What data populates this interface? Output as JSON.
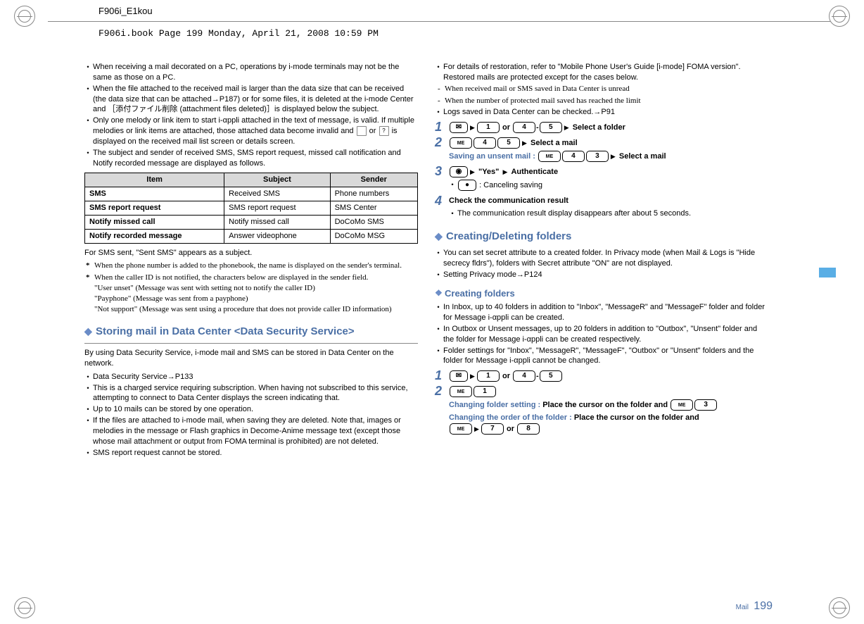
{
  "doc_id": "F906i_E1kou",
  "book_line": "F906i.book  Page 199  Monday, April 21, 2008  10:59 PM",
  "page_label": "Mail",
  "page_number": "199",
  "left": {
    "bullets": [
      "When receiving a mail decorated on a PC, operations by i-mode terminals may not be the same as those on a PC.",
      "When the file attached to the received mail is larger than the data size that can be received (the data size that can be attached→P187) or for some files, it is deleted at the i-mode Center and ［添付ファイル削除 (attachment files deleted)］is displayed below the subject.",
      "Only one melody or link item to start i-αppli attached in the text of message, is valid. If multiple melodies or link items are attached, those attached data become invalid and  or  is displayed on the received mail list screen or details screen.",
      "The subject and sender of received SMS, SMS report request, missed call notification and Notify recorded message are displayed as follows."
    ],
    "table": {
      "headers": [
        "Item",
        "Subject",
        "Sender"
      ],
      "rows": [
        [
          "SMS",
          "Received SMS",
          "Phone numbers"
        ],
        [
          "SMS report request",
          "SMS report request",
          "SMS Center"
        ],
        [
          "Notify missed call",
          "Notify missed call",
          "DoCoMo SMS"
        ],
        [
          "Notify recorded message",
          "Answer videophone",
          "DoCoMo MSG"
        ]
      ]
    },
    "after_table": "For SMS sent, \"Sent SMS\" appears as a subject.",
    "notes": [
      "When the phone number is added to the phonebook, the name is displayed on the sender's terminal.",
      "When the caller ID is not notified, the characters below are displayed in the sender field.\n\"User unset\" (Message was sent with setting not to notify the caller ID)\n\"Payphone\" (Message was sent from a payphone)\n\"Not support\" (Message was sent using a procedure that does not provide caller ID information)"
    ],
    "heading1": "Storing mail in Data Center <Data Security Service>",
    "para1": "By using Data Security Service, i-mode mail and SMS can be stored in Data Center on the network.",
    "bullets2": [
      "Data Security Service→P133",
      "This is a charged service requiring subscription. When having not subscribed to this service, attempting to connect to Data Center displays the screen indicating that.",
      "Up to 10 mails can be stored by one operation.",
      "If the files are attached to i-mode mail, when saving they are deleted. Note that, images or melodies in the message or Flash graphics in Decome-Anime message text (except those whose mail attachment or output from FOMA terminal is prohibited) are not deleted.",
      "SMS report request cannot be stored."
    ]
  },
  "right": {
    "bullets": [
      "For details of restoration, refer to \"Mobile Phone User's Guide [i-mode] FOMA version\". Restored mails are protected except for the cases below."
    ],
    "sub_bullets": [
      "When received mail or SMS saved in Data Center is unread",
      "When the number of protected mail saved has reached the limit"
    ],
    "bullets2": [
      "Logs saved in Data Center can be checked.→P91"
    ],
    "steps": [
      {
        "n": "1",
        "keys_a": [
          "✉",
          "▶",
          "1"
        ],
        "or": " or ",
        "keys_b": [
          "4",
          "-",
          "5",
          "▶"
        ],
        "tail": "Select a folder"
      },
      {
        "n": "2",
        "keys_a": [
          "ME",
          "4",
          "5",
          "▶"
        ],
        "tail": "Select a mail",
        "hint_label": "Saving an unsent mail : ",
        "hint_keys": [
          "ME",
          "4",
          "3",
          "▶"
        ],
        "hint_tail": "Select a mail"
      },
      {
        "n": "3",
        "keys_a": [
          "📷",
          "▶"
        ],
        "mid": "\"Yes\"",
        "keys_b": [
          "▶"
        ],
        "tail": "Authenticate",
        "sub_bullet_label": "",
        "sub_bullet_keys": [
          "●"
        ],
        "sub_bullet_tail": ": Canceling saving"
      },
      {
        "n": "4",
        "plain_bold": "Check the communication result",
        "sub_bullet_tail2": "The communication result display disappears after about 5 seconds."
      }
    ],
    "heading2": "Creating/Deleting folders",
    "bullets3": [
      "You can set secret attribute to a created folder. In Privacy mode (when Mail & Logs is \"Hide secrecy fldrs\"), folders with Secret attribute \"ON\" are not displayed.",
      "Setting Privacy mode→P124"
    ],
    "heading3": "Creating folders",
    "bullets4": [
      "In Inbox, up to 40 folders in addition to \"Inbox\", \"MessageR\" and \"MessageF\" folder and folder for Message i-αppli can be created.",
      "In Outbox or Unsent messages, up to 20 folders in addition to \"Outbox\", \"Unsent\" folder and the folder for Message i-αppli can be created respectively.",
      "Folder settings for \"Inbox\", \"MessageR\", \"MessageF\", \"Outbox\" or \"Unsent\" folders and the folder for Message i-αppli cannot be changed."
    ],
    "steps2": [
      {
        "n": "1",
        "keys_a": [
          "✉",
          "▶",
          "1"
        ],
        "or": " or ",
        "keys_b": [
          "4",
          "-",
          "5"
        ]
      },
      {
        "n": "2",
        "keys_a": [
          "ME",
          "1"
        ],
        "hint1_label": "Changing folder setting : ",
        "hint1_tail": "Place the cursor on the folder and ",
        "hint1_keys": [
          "ME",
          "3"
        ],
        "hint2_label": "Changing the order of the folder : ",
        "hint2_tail": "Place the cursor on the folder and ",
        "hint2_keys": [
          "ME",
          "▶",
          "7"
        ],
        "hint2_or": " or ",
        "hint2_keys2": [
          "8"
        ]
      }
    ]
  }
}
